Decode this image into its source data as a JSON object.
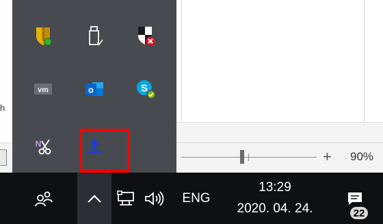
{
  "app": {
    "edge_char": "h",
    "zoom": {
      "level": "90%",
      "plus": "+",
      "fraction": 0.45
    }
  },
  "tray_flyout": {
    "icons": [
      {
        "name": "security-shield-icon",
        "color": "#e8b100",
        "badge_color": "#2fb52f"
      },
      {
        "name": "usb-drive-icon",
        "color": "#e6e6e6"
      },
      {
        "name": "windows-security-icon",
        "color": "#c8161d",
        "badge_color": "#e81123"
      },
      {
        "name": "vmware-icon",
        "color": "#f5f5f5",
        "text": "vm"
      },
      {
        "name": "outlook-icon",
        "color": "#0a64c8",
        "text": "o"
      },
      {
        "name": "skype-icon",
        "color": "#00a8e8",
        "badge_color": "#7fba00"
      },
      {
        "name": "onenote-clipper-icon",
        "color": "#7c2fb0",
        "text": "N"
      },
      {
        "name": "upload-icon",
        "color": "#2340c8"
      }
    ]
  },
  "taskbar": {
    "language": "ENG",
    "clock": {
      "time": "13:29",
      "date": "2020. 04. 24."
    },
    "notifications_count": "22"
  }
}
